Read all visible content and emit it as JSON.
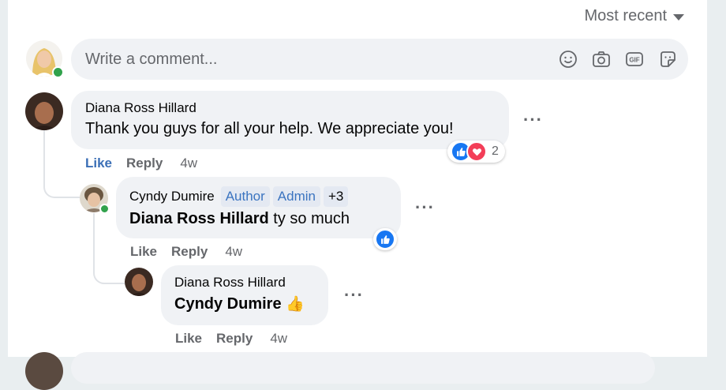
{
  "sort": {
    "label": "Most recent"
  },
  "composer": {
    "placeholder": "Write a comment...",
    "icons": [
      "emoji-icon",
      "camera-icon",
      "gif-icon",
      "sticker-icon"
    ]
  },
  "comments": [
    {
      "author": "Diana Ross Hillard",
      "text": "Thank you guys for all your help. We appreciate you!",
      "reactions": {
        "types": [
          "like",
          "love"
        ],
        "count": "2"
      },
      "actions": {
        "like": "Like",
        "reply": "Reply",
        "time": "4w"
      }
    },
    {
      "author": "Cyndy Dumire",
      "badges": [
        "Author",
        "Admin",
        "+3"
      ],
      "mention": "Diana Ross Hillard",
      "text": " ty so much",
      "reactions": {
        "types": [
          "like"
        ]
      },
      "actions": {
        "like": "Like",
        "reply": "Reply",
        "time": "4w"
      }
    },
    {
      "author": "Diana Ross Hillard",
      "mention": "Cyndy Dumire",
      "emoji": "👍",
      "actions": {
        "like": "Like",
        "reply": "Reply",
        "time": "4w"
      }
    }
  ],
  "colors": {
    "accent": "#1877f2",
    "love": "#f33e58",
    "online": "#31a24c",
    "bubble": "#f0f2f5"
  }
}
